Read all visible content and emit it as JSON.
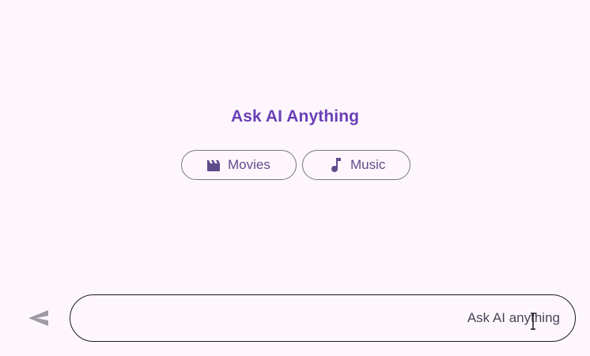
{
  "header": {
    "title": "Ask AI Anything"
  },
  "suggestions": [
    {
      "label": "Movies",
      "icon": "movie-clapper-icon"
    },
    {
      "label": "Music",
      "icon": "music-note-icon"
    }
  ],
  "composer": {
    "placeholder": "Ask AI anything",
    "value": "",
    "send_icon": "send-icon"
  },
  "colors": {
    "background": "#fdf7fd",
    "accent": "#6a3fb7",
    "chip_text": "#5f4b8b",
    "chip_border": "#7a7680",
    "input_border": "#1f1b24",
    "send_disabled": "#9e9aa3"
  }
}
